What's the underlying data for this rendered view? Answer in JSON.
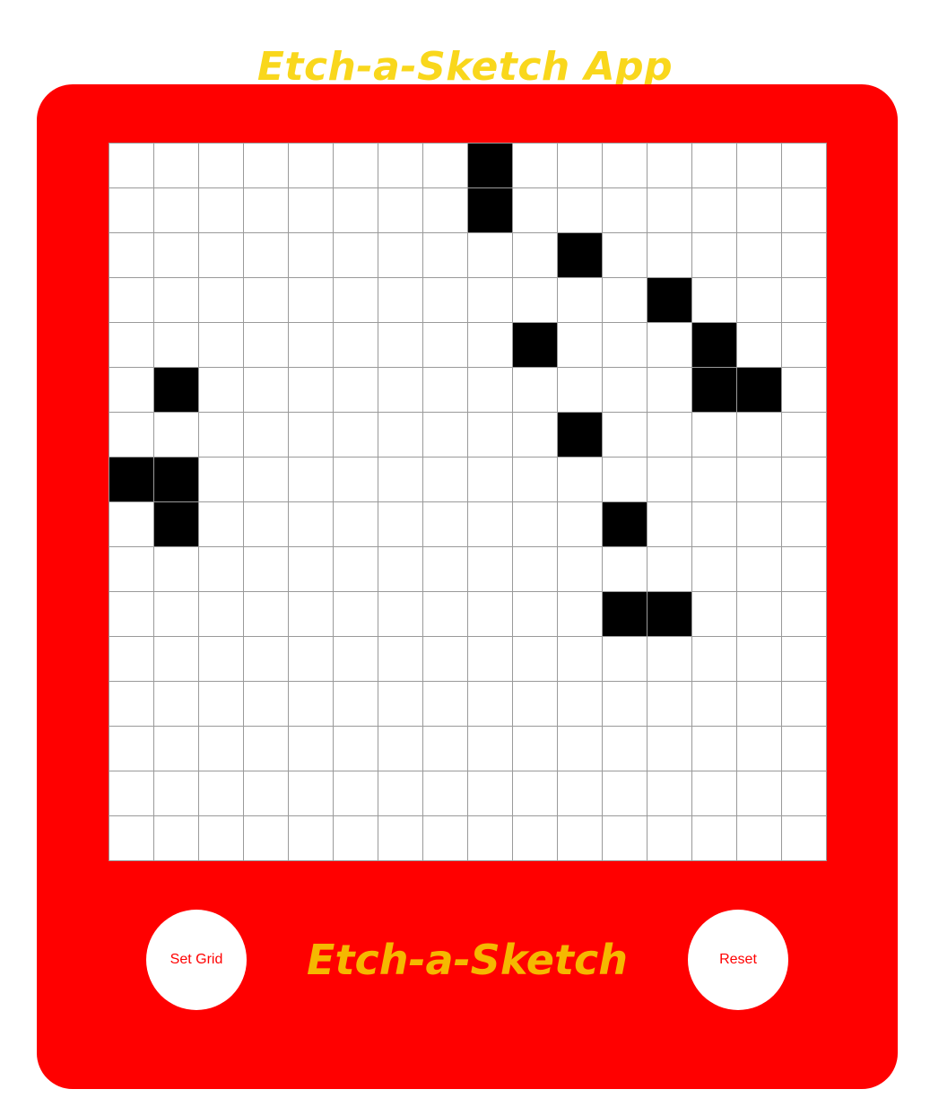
{
  "header": {
    "title": "Etch-a-Sketch App"
  },
  "device": {
    "brand_label": "Etch-a-Sketch",
    "set_grid_label": "Set Grid",
    "reset_label": "Reset"
  },
  "grid": {
    "size": 16,
    "filled_cells": [
      [
        0,
        8
      ],
      [
        1,
        8
      ],
      [
        2,
        10
      ],
      [
        3,
        12
      ],
      [
        4,
        9
      ],
      [
        4,
        13
      ],
      [
        5,
        1
      ],
      [
        5,
        13
      ],
      [
        5,
        14
      ],
      [
        6,
        10
      ],
      [
        7,
        0
      ],
      [
        7,
        1
      ],
      [
        8,
        1
      ],
      [
        8,
        11
      ],
      [
        10,
        11
      ],
      [
        10,
        12
      ]
    ]
  },
  "colors": {
    "frame": "#ff0000",
    "title": "#f9d71c",
    "brand": "#f5b800",
    "button_text": "#ff0000",
    "filled_cell": "#000000",
    "empty_cell": "#ffffff",
    "grid_line": "#9a9a9a"
  }
}
